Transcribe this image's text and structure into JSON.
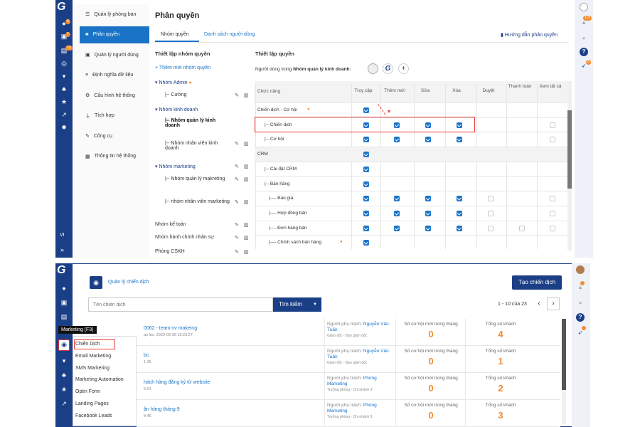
{
  "top": {
    "logo": "G",
    "left_badges": [
      "3",
      "7",
      "10"
    ],
    "bottom_label": "VI",
    "right_badges": [
      "118",
      "8"
    ],
    "menu": [
      {
        "label": "Quản lý phòng ban",
        "icon": "sliders-icon"
      },
      {
        "label": "Phân quyền",
        "icon": "org-chart-icon",
        "active": true
      },
      {
        "label": "Quản lý người dùng",
        "icon": "user-card-icon"
      },
      {
        "label": "Định nghĩa dữ liệu",
        "icon": "list-icon"
      },
      {
        "label": "Cấu hình hệ thống",
        "icon": "gears-icon"
      },
      {
        "label": "Tích hợp",
        "icon": "plug-icon"
      },
      {
        "label": "Công cụ",
        "icon": "wrench-icon"
      },
      {
        "label": "Thông tin hệ thống",
        "icon": "table-icon"
      }
    ],
    "title": "Phân quyền",
    "tabs": [
      "Nhóm quyền",
      "Danh sách người dùng"
    ],
    "guide": "Hướng dẫn phân quyền",
    "left_title": "Thiết lập nhóm quyền",
    "add_group": "+ Thêm mới nhóm quyền",
    "groups": [
      {
        "label": "▾ Nhóm Admin",
        "dot": true
      },
      {
        "label": "|-- Cường",
        "actions": true
      },
      {
        "label": "▾ Nhóm kinh doanh"
      },
      {
        "label": "|-- Nhóm quản lý kinh doanh",
        "bold": true
      },
      {
        "label": "|-- Nhóm nhân viên kinh doanh",
        "actions": true
      },
      {
        "label": "▾ Nhóm marketing",
        "actions": true
      },
      {
        "label": "|-- Nhóm quản lý makreting",
        "actions": true
      },
      {
        "label": "|-- nhóm nhân viên marketing",
        "actions": true
      },
      {
        "label": "Nhóm kế toán",
        "actions": true
      },
      {
        "label": "Nhóm hành chính nhân sự",
        "actions": true
      },
      {
        "label": "Phòng CSKH",
        "actions": true
      }
    ],
    "right_title": "Thiết lập quyền",
    "users_prefix": "Người dùng trong",
    "users_group": "Nhóm quản lý kinh doanh:",
    "columns": [
      "Chức năng",
      "Truy cập",
      "Thêm mới",
      "Sửa",
      "Xóa",
      "Duyệt",
      "Thanh toán",
      "Xem tất cả"
    ],
    "rows": [
      {
        "label": "Chiến dịch - Cơ hội",
        "cells": [
          1,
          0,
          0,
          0,
          0,
          0,
          0
        ]
      },
      {
        "label": "|-- Chiến dịch",
        "cells": [
          1,
          1,
          1,
          1,
          0,
          0,
          2
        ]
      },
      {
        "label": "|-- Cơ hội",
        "cells": [
          1,
          1,
          1,
          1,
          0,
          0,
          2
        ]
      },
      {
        "label": "CRM",
        "cells": [
          1,
          0,
          0,
          0,
          0,
          0,
          0
        ]
      },
      {
        "label": "|-- Cài đặt CRM",
        "cells": [
          1,
          0,
          0,
          0,
          0,
          0,
          0
        ]
      },
      {
        "label": "|-- Bán hàng",
        "cells": [
          1,
          0,
          0,
          0,
          0,
          0,
          0
        ]
      },
      {
        "label": "|---- Báo giá",
        "cells": [
          1,
          1,
          1,
          1,
          2,
          0,
          2
        ]
      },
      {
        "label": "|---- Hợp đồng bán",
        "cells": [
          1,
          1,
          1,
          1,
          2,
          0,
          2
        ]
      },
      {
        "label": "|---- Đơn hàng bán",
        "cells": [
          1,
          1,
          1,
          1,
          2,
          2,
          2
        ]
      },
      {
        "label": "|---- Chính sách bán hàng",
        "cells": [
          1,
          0,
          0,
          0,
          0,
          0,
          0
        ]
      }
    ]
  },
  "bottom": {
    "logo": "G",
    "tooltip": "Marketing (F3)",
    "flyout": [
      "Chiến Dịch",
      "Email Marketing",
      "SMS Marketing",
      "Marketing Automation",
      "Optin Form",
      "Landing Pages",
      "Facebook Leads"
    ],
    "page_title": "Quản lý chiến dịch",
    "create_button": "Tạo chiến dịch",
    "search_placeholder": "Tên chiến dịch",
    "search_button": "Tìm kiếm",
    "pagination": "1 - 10 của 23",
    "cards": [
      {
        "name": "0062 - team nv makeing",
        "date": "ạo lúc: 2020-09-30 15:23:27",
        "owner_label": "Người phụ trách:",
        "owner": "Nguyễn Văn Tuấn",
        "role": "Giám đốc - Ban giám đốc",
        "opp_label": "Số cơ hội mới trong tháng",
        "opp": "0",
        "cust_label": "Tổng số khách",
        "cust": "4"
      },
      {
        "name": "bc",
        "date": "1:35",
        "owner_label": "Người phụ trách:",
        "owner": "Nguyễn Văn Tuấn",
        "role": "Giám đốc - Ban giám đốc",
        "opp_label": "Số cơ hội mới trong tháng",
        "opp": "0",
        "cust_label": "Tổng số khách",
        "cust": "1"
      },
      {
        "name": "hách hàng đăng ký từ website",
        "date": "5:01",
        "owner_label": "Người phụ trách:",
        "owner": "Phòng Marketing",
        "role": "Trưởng phòng - Chi nhánh 3",
        "opp_label": "Số cơ hội mới trong tháng",
        "opp": "0",
        "cust_label": "Tổng số khách",
        "cust": "2"
      },
      {
        "name": "ận hàng tháng 9",
        "date": "8:46",
        "owner_label": "Người phụ trách:",
        "owner": "Phòng Marketing",
        "role": "Trưởng phòng - Chi nhánh 3",
        "opp_label": "Số cơ hội mới trong tháng",
        "opp": "0",
        "cust_label": "Tổng số khách",
        "cust": "3"
      }
    ]
  },
  "colors": {
    "navy": "#1b3f87",
    "blue": "#1a73c7",
    "orange": "#f28b30",
    "red": "#e53935"
  }
}
